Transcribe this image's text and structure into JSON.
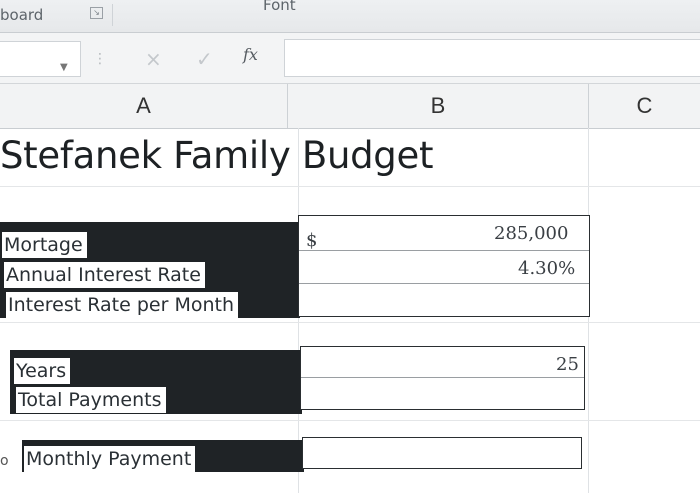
{
  "ribbon": {
    "clipboard_label": "board",
    "font_label": "Font"
  },
  "formula_bar": {
    "fx_label": "fx",
    "cancel_glyph": "×",
    "enter_glyph": "✓"
  },
  "columns": [
    "A",
    "B",
    "C"
  ],
  "sheet": {
    "title": "Stefanek Family Budget",
    "rows": {
      "mortgage": {
        "label": "Mortage",
        "currency": "$",
        "value": "285,000"
      },
      "annual_rate": {
        "label": "Annual Interest Rate",
        "value": "4.30%"
      },
      "monthly_rate": {
        "label": "Interest Rate per Month",
        "value": ""
      },
      "years": {
        "label": "Years",
        "value": "25"
      },
      "total_payments": {
        "label": "Total Payments",
        "value": ""
      },
      "monthly_payment": {
        "label": "Monthly Payment",
        "value": "",
        "row_number_fragment": "o"
      }
    }
  }
}
